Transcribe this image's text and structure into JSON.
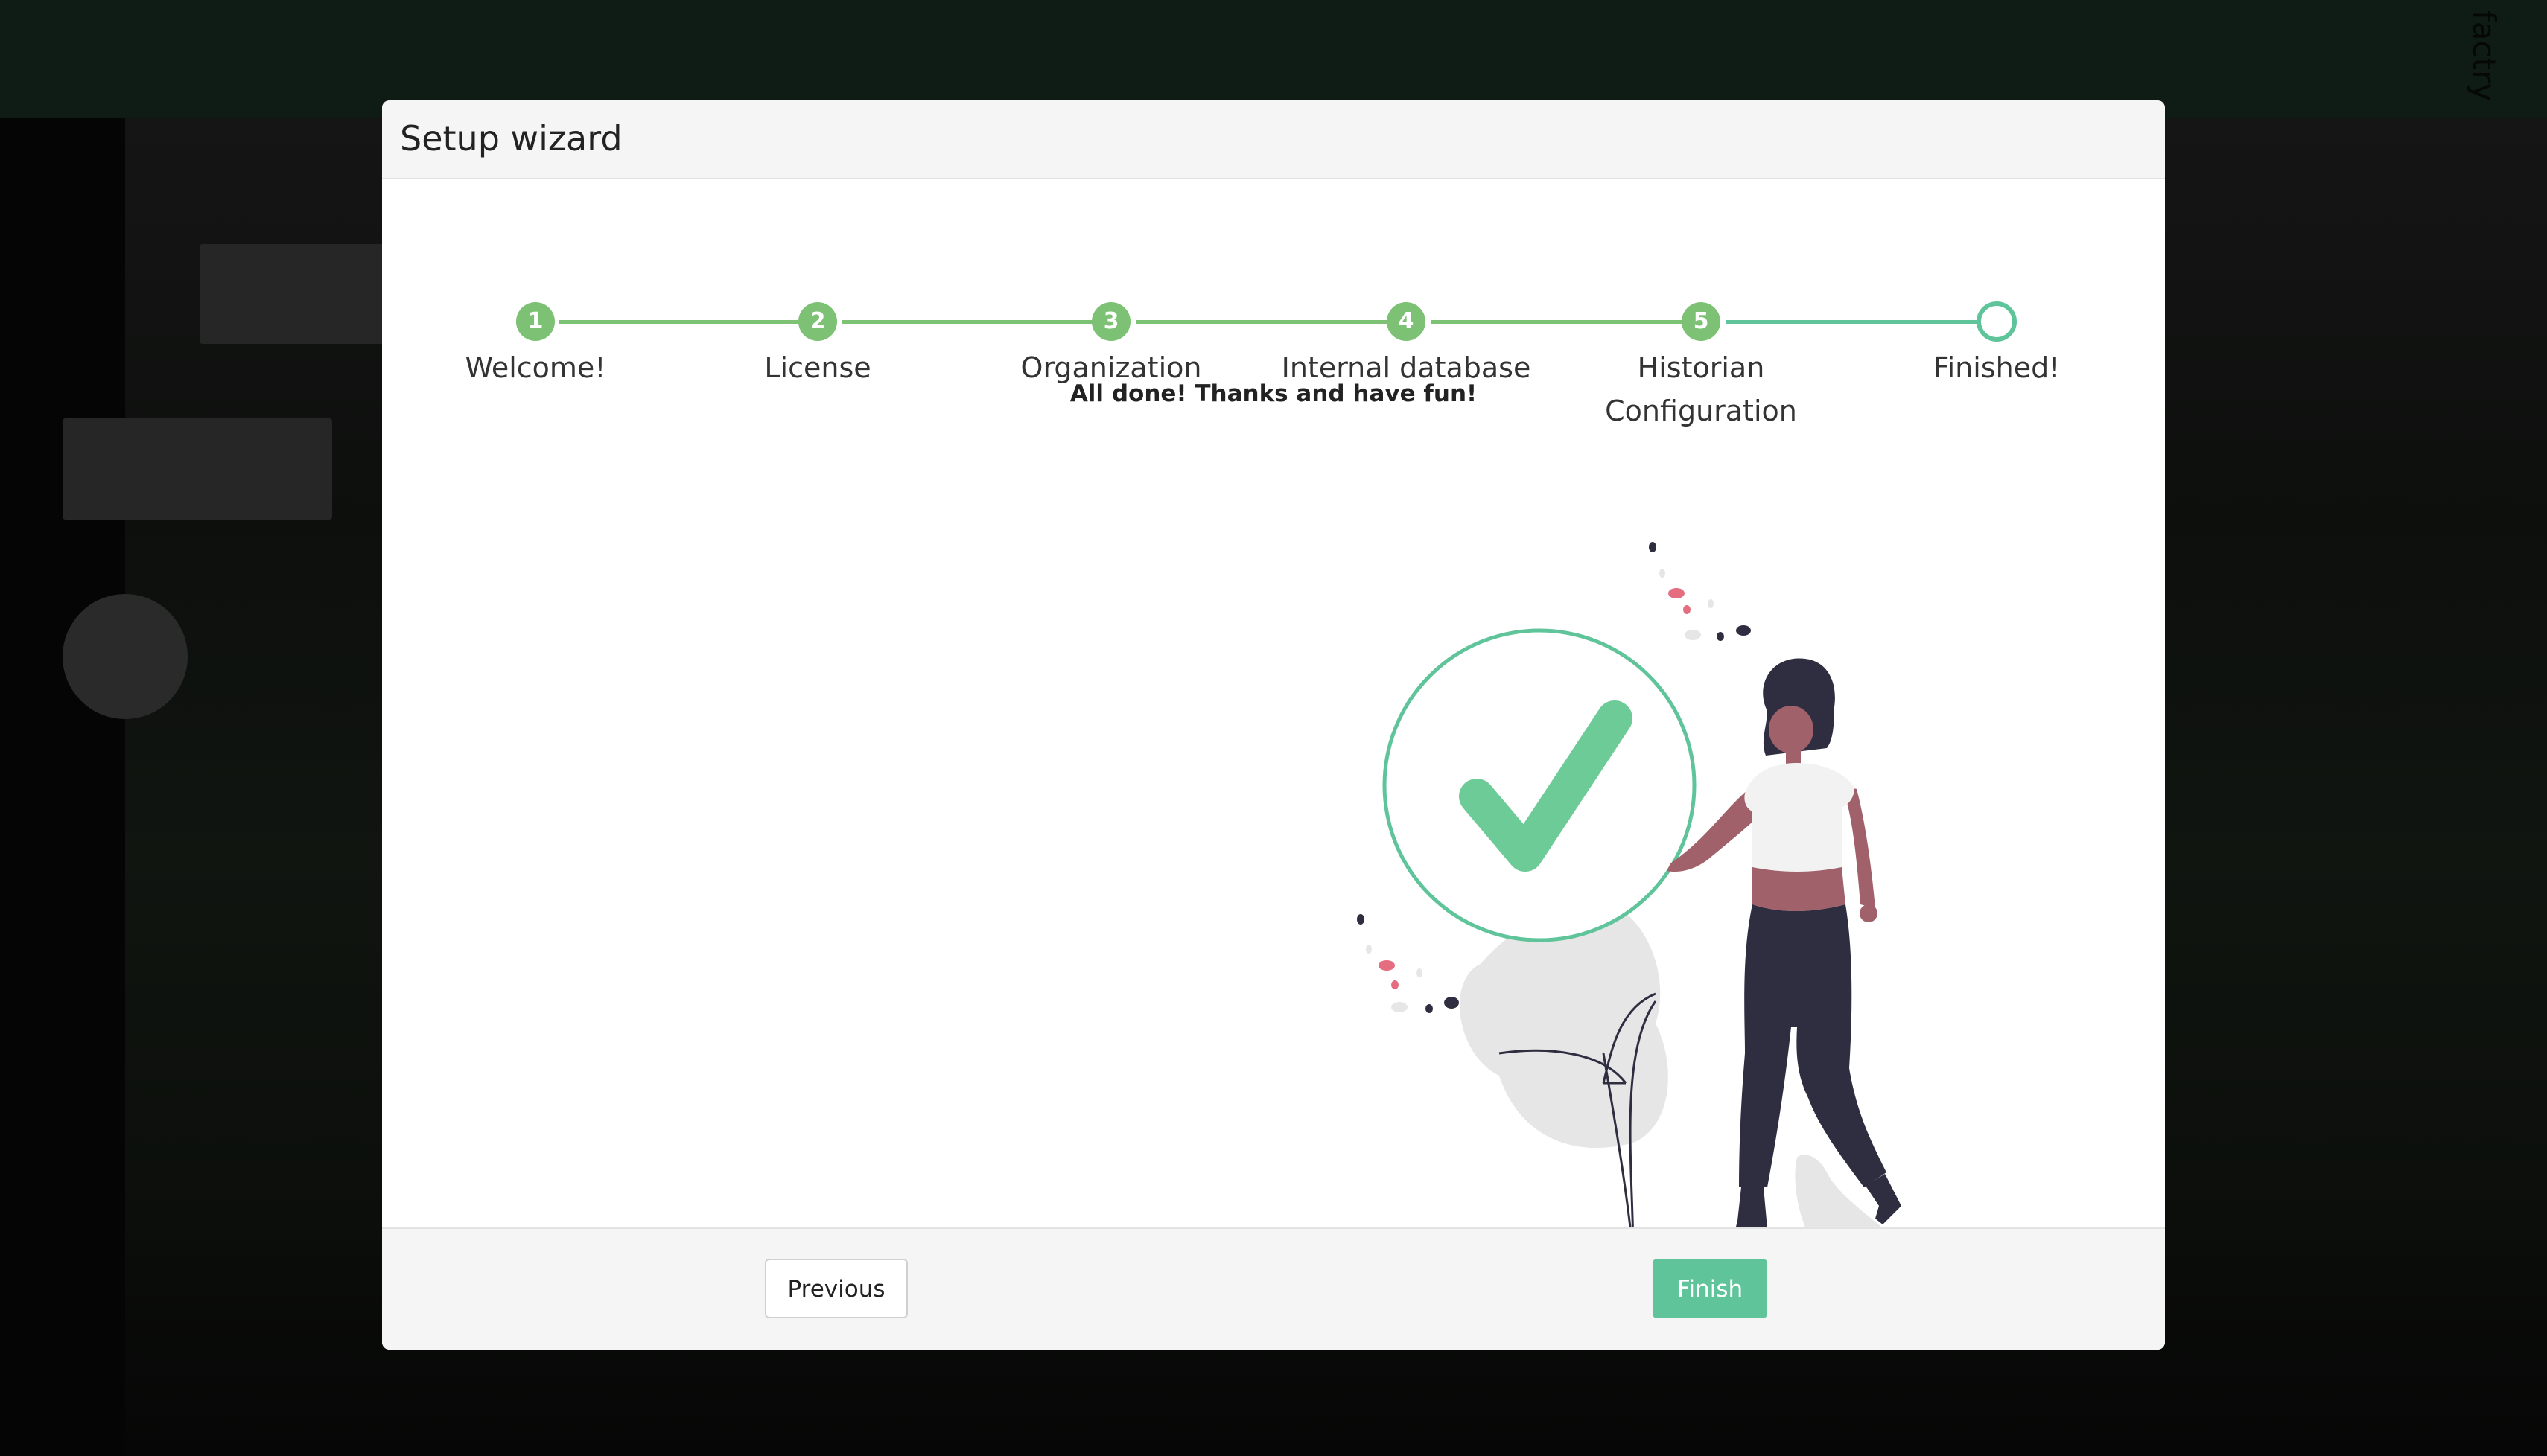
{
  "background": {
    "brand": "factry"
  },
  "modal": {
    "title": "Setup wizard"
  },
  "steps": [
    {
      "number": "1",
      "label": "Welcome!",
      "status": "completed"
    },
    {
      "number": "2",
      "label": "License",
      "status": "completed"
    },
    {
      "number": "3",
      "label": "Organization",
      "status": "completed"
    },
    {
      "number": "4",
      "label": "Internal database",
      "status": "completed"
    },
    {
      "number": "5",
      "label": "Historian Configuration",
      "status": "completed"
    },
    {
      "number": "",
      "label": "Finished!",
      "status": "current"
    }
  ],
  "content": {
    "message": "All done! Thanks and have fun!",
    "illustration": "success-checkmark-illustration"
  },
  "footer": {
    "previous_label": "Previous",
    "finish_label": "Finish"
  },
  "colors": {
    "step_completed": "#7cc174",
    "step_current": "#5fc49a",
    "finish_button": "#5fc49a"
  }
}
